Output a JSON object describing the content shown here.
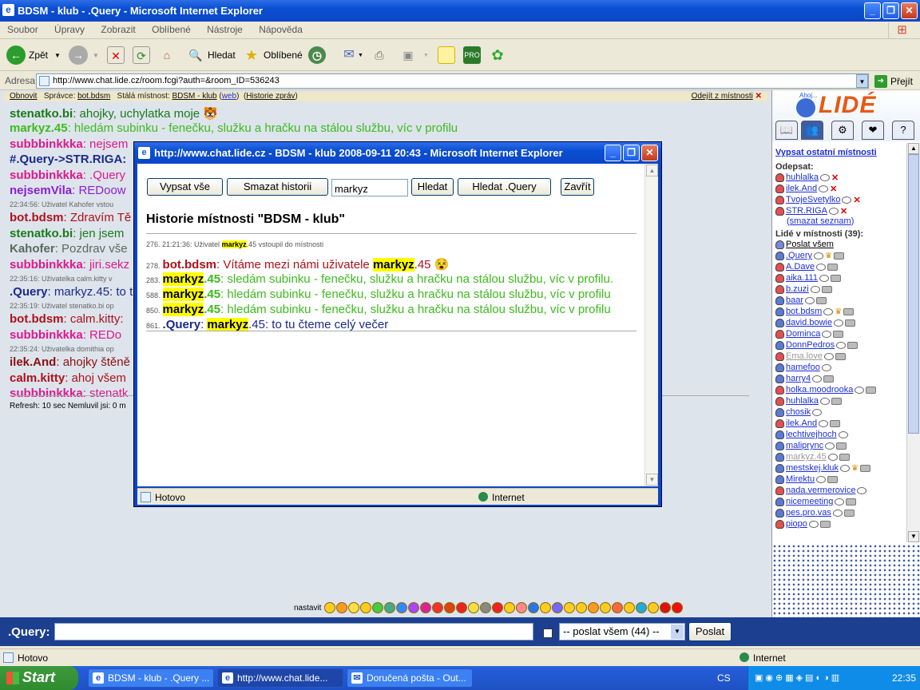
{
  "window": {
    "title": "BDSM - klub - .Query - Microsoft Internet Explorer",
    "min": "_",
    "max": "❐",
    "close": "✕"
  },
  "menu": [
    "Soubor",
    "Úpravy",
    "Zobrazit",
    "Oblíbené",
    "Nástroje",
    "Nápověda"
  ],
  "toolbar": {
    "back": "Zpět",
    "search": "Hledat",
    "favorites": "Oblíbené"
  },
  "address": {
    "label": "Adresa",
    "url": "http://www.chat.lide.cz/room.fcgi?auth=&room_ID=536243",
    "go": "Přejít"
  },
  "topnav": {
    "refresh": "Obnovit",
    "admin_label": "Správce:",
    "admin": "bot.bdsm",
    "room_label": "Stálá místnost:",
    "room": "BDSM - klub",
    "web": "web",
    "history": "Historie zpráv",
    "leave": "Odejít z místnosti"
  },
  "chat": [
    {
      "nick": "stenatko.bi",
      "text": ": ahojky, uchylatka moje 🐯",
      "color": "#1a7a1a"
    },
    {
      "nick": "markyz.45",
      "text": ": hledám subinku - fenečku, služku a hračku na stálou službu, víc v profilu",
      "color": "#3dbb1e"
    },
    {
      "nick": "subbbinkkka",
      "text": ": nejsem",
      "color": "#e0188e"
    },
    {
      "nick": "#.Query->STR.RIGA:",
      "text": "",
      "color": "#1a2a8a"
    },
    {
      "nick": "subbbinkkka",
      "text": ": .Query",
      "color": "#e0188e"
    },
    {
      "nick": "nejsemVila",
      "text": ": REDoow",
      "color": "#8a1fd6"
    },
    {
      "sys": "22:34:56: Uživatel Kahofer vstou"
    },
    {
      "nick": "bot.bdsm",
      "text": ": Zdravím Tě",
      "color": "#b0101a"
    },
    {
      "nick": "stenatko.bi",
      "text": ": jen jsem",
      "color": "#1a7a1a"
    },
    {
      "nick": "Kahofer",
      "text": ": Pozdrav vše",
      "color": "#5a6a5a"
    },
    {
      "nick": "subbbinkkka",
      "text": ": jiri.sekz",
      "color": "#e0188e"
    },
    {
      "sys": "22:35:16: Uživatelka calm.kitty v"
    },
    {
      "nick": ".Query",
      "text": ": markyz.45: to t",
      "color": "#1a2a8a"
    },
    {
      "sys": "22:35:19: Uživatel stenatko.bi op"
    },
    {
      "nick": "bot.bdsm",
      "text": ": calm.kitty:",
      "color": "#b0101a"
    },
    {
      "nick": "subbbinkkka",
      "text": ": REDo",
      "color": "#e0188e"
    },
    {
      "sys": "22:35:24: Uživatelka domithia op"
    },
    {
      "nick": "ilek.And",
      "text": ": ahojky štěně",
      "color": "#8a1010"
    },
    {
      "nick": "calm.kitty",
      "text": ": ahoj všem",
      "color": "#b0101a"
    },
    {
      "nick": "subbbinkkka",
      "text": ": stenatk",
      "color": "#e0188e"
    }
  ],
  "refresh": "Refresh: 10 sec    Nemluvil jsi: 0 m",
  "smileys_label": "nastavit",
  "input": {
    "label": ".Query:",
    "send_to": "-- poslat všem (44) --",
    "send": "Poslat"
  },
  "status": {
    "left": "Hotovo",
    "zone": "Internet"
  },
  "taskbar": {
    "start": "Start",
    "tasks": [
      "BDSM - klub - .Query ...",
      "http://www.chat.lide...",
      "Doručená pošta - Out..."
    ],
    "lang": "CS",
    "time": "22:35"
  },
  "right": {
    "logo": "LIDÉ",
    "ahoj": "Ahoj...",
    "list_rooms": "Vypsat ostatní místnosti",
    "away_head": "Odepsat:",
    "away": [
      "huhlalka",
      "ilek.And",
      "TvojeSvetylko",
      "STR.RIGA"
    ],
    "clear": "smazat seznam",
    "people_head": "Lidé v místnosti (39):",
    "send_all": "Poslat všem",
    "people": [
      ".Query",
      "A.Dave",
      "aika.111",
      "b.zuzi",
      "baar",
      "bot.bdsm",
      "david.bowie",
      "Dominca",
      "DonnPedros",
      "Ema.love",
      "hamefoo",
      "harry4",
      "holka.moodrooka",
      "huhlalka",
      "chosik",
      "ilek.And",
      "lechtivejhoch",
      "maliprync",
      "markyz.45",
      "mestskej.kluk",
      "Mirektu",
      "nada.vermerovice",
      "nicemeeting",
      "pes.pro.vas",
      "piopo"
    ]
  },
  "popup": {
    "title": "http://www.chat.lide.cz - BDSM - klub 2008-09-11 20:43 - Microsoft Internet Explorer",
    "btn_all": "Vypsat vše",
    "btn_clear": "Smazat historii",
    "search_value": "markyz",
    "btn_search": "Hledat",
    "btn_search_q": "Hledat .Query",
    "btn_close": "Zavřít",
    "heading": "Historie místnosti \"BDSM - klub\"",
    "sys": "276. 21:21:36: Uživatel",
    "sys_nick": "markyz",
    "sys_tail": ".45 vstoupil do místnosti",
    "lines": [
      {
        "n": "278.",
        "nick": "bot.bdsm",
        "pre": ": Vítáme mezi námi uživatele ",
        "hl": "markyz",
        "post": ".45 😵",
        "color": "#b0101a"
      },
      {
        "n": "283.",
        "nick": "markyz",
        "nick2": ".45",
        "pre": ": sledám subinku - fenečku, služku a hračku na stálou službu, víc v profilu.",
        "color": "#3dbb1e"
      },
      {
        "n": "588.",
        "nick": "markyz",
        "nick2": ".45",
        "pre": ": hledám subinku - fenečku, služku a hračku na stálou službu, víc v profilu",
        "color": "#3dbb1e"
      },
      {
        "n": "850.",
        "nick": "markyz",
        "nick2": ".45",
        "pre": ": hledám subinku - fenečku, služku a hračku na stálou službu, víc v profilu",
        "color": "#3dbb1e"
      },
      {
        "n": "861.",
        "nick": ".Query",
        "pre": ": ",
        "hl": "markyz",
        "post": ".45: to tu čteme celý večer",
        "color": "#1a2a8a"
      }
    ],
    "status": "Hotovo",
    "zone": "Internet"
  }
}
